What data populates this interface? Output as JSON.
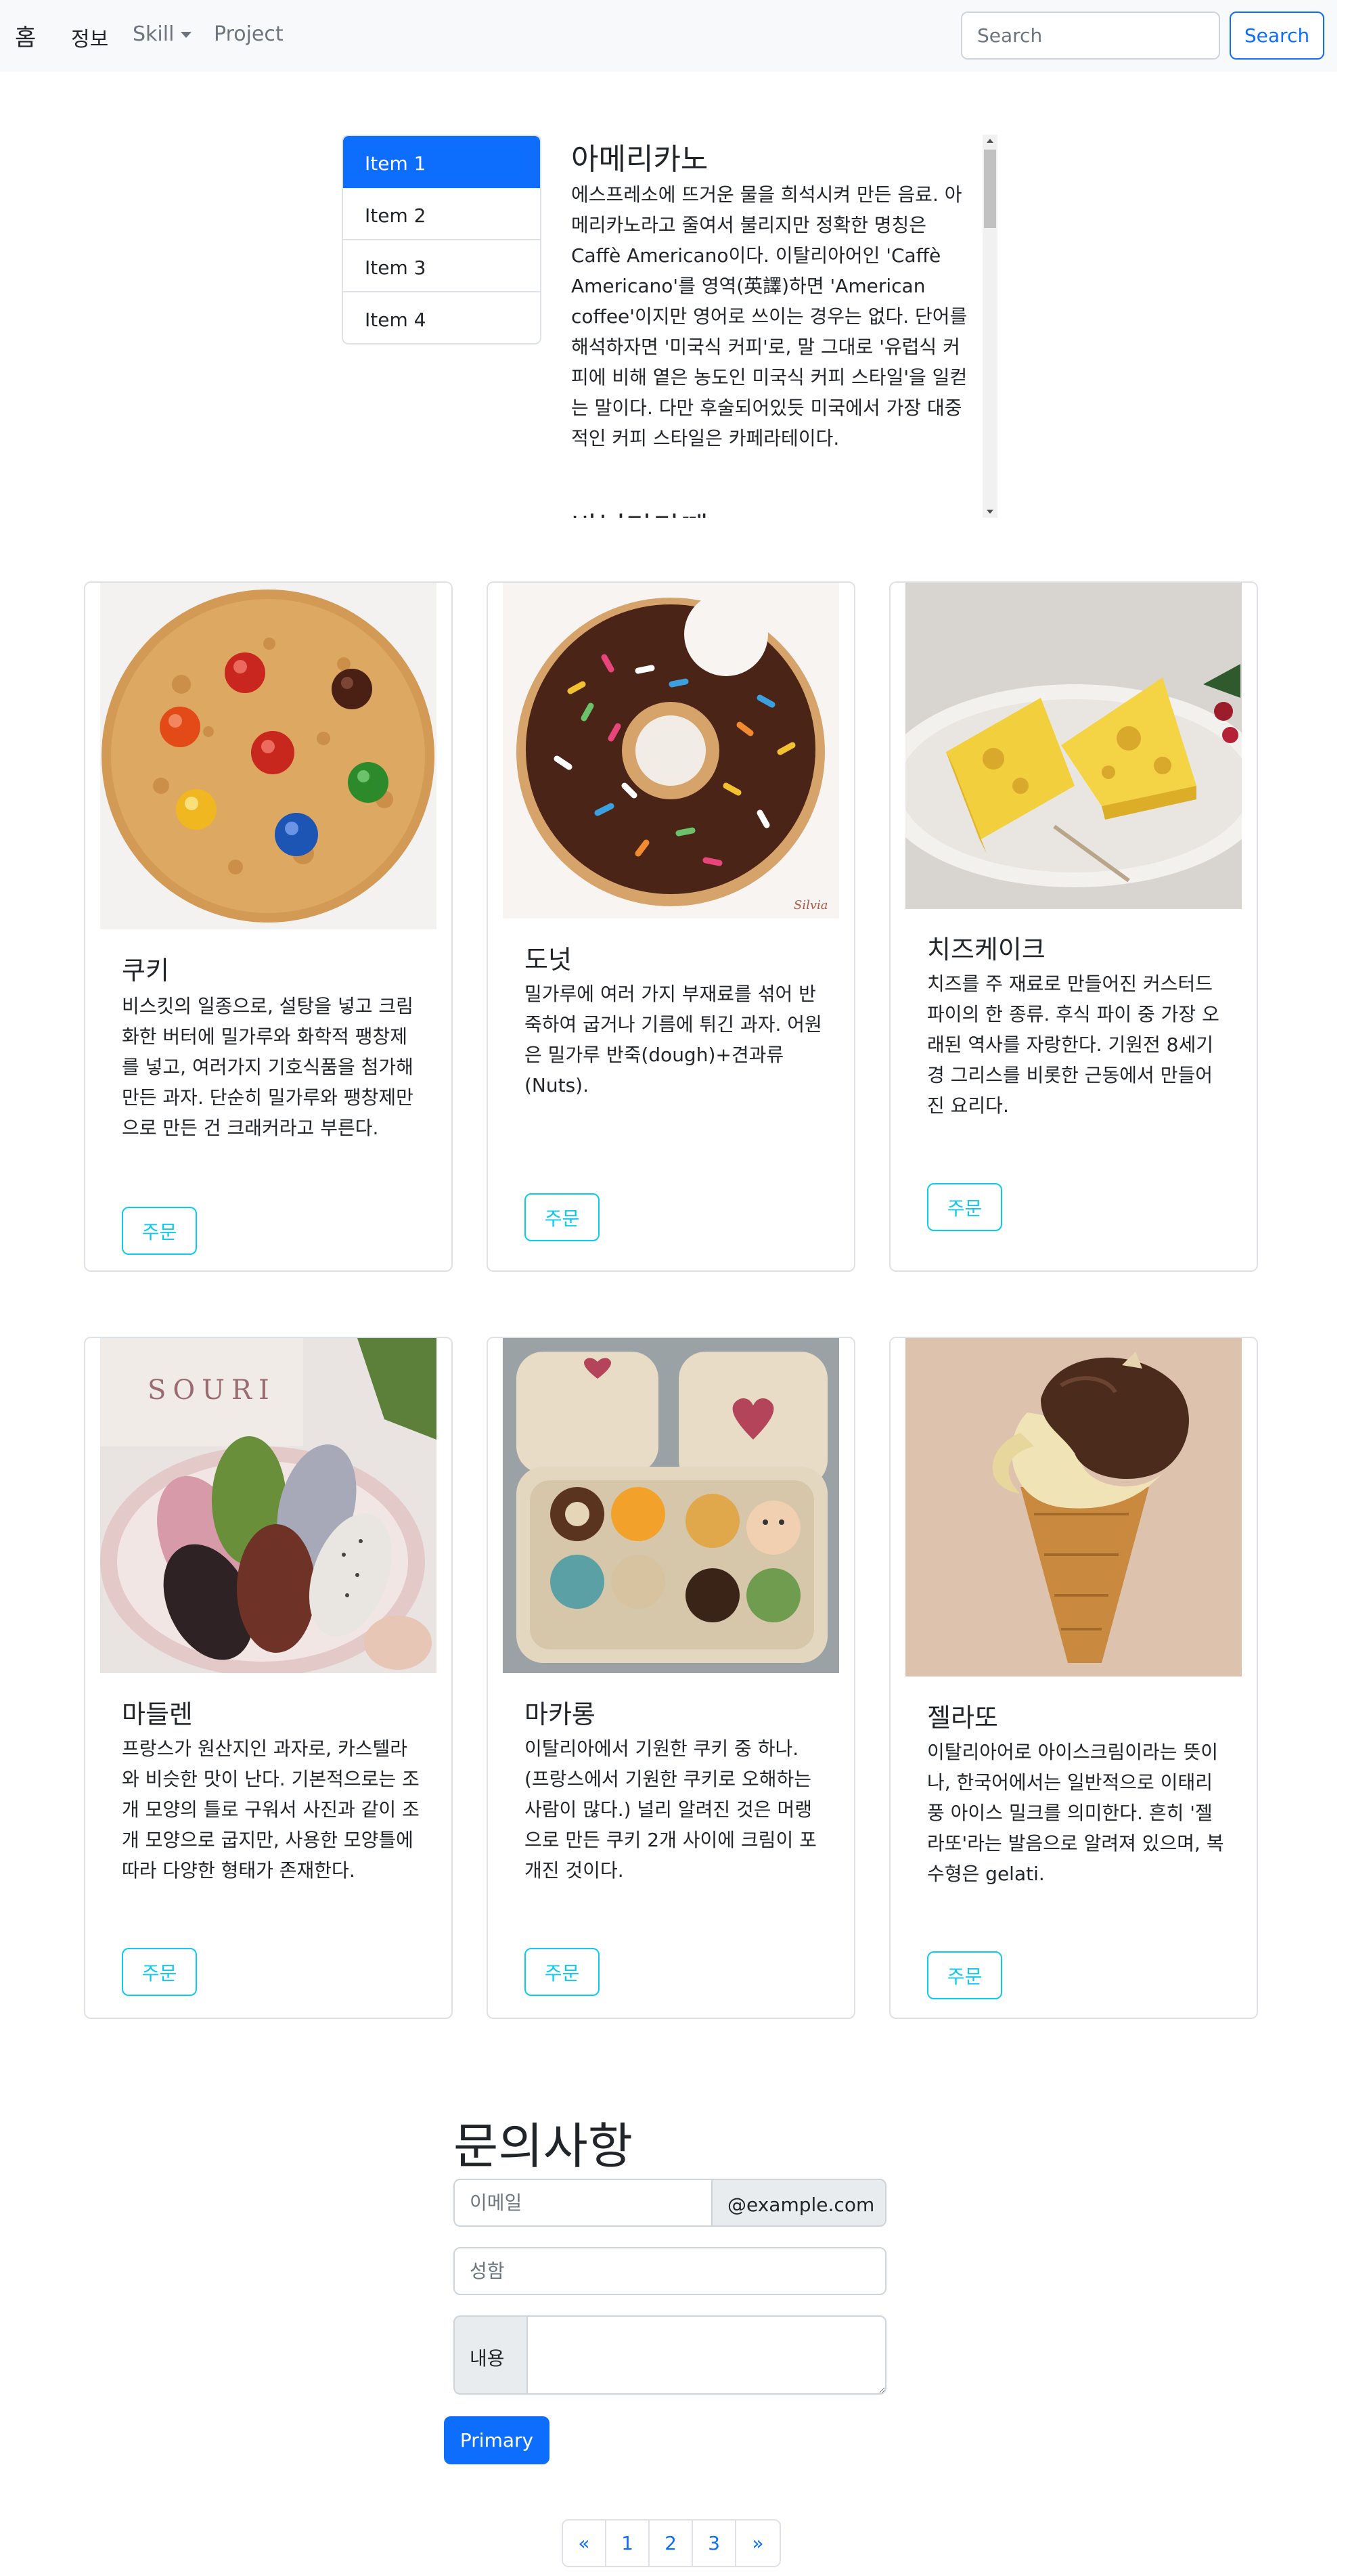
{
  "navbar": {
    "brand": "홈",
    "links": {
      "info": "정보",
      "skill": "Skill",
      "project": "Project"
    },
    "search_placeholder": "Search",
    "search_button": "Search"
  },
  "scrollspy": {
    "items": [
      "Item 1",
      "Item 2",
      "Item 3",
      "Item 4"
    ],
    "active_item": "Item 1",
    "heading": "아메리카노",
    "text": "에스프레소에 뜨거운 물을 희석시켜 만든 음료. 아메리카노라고 줄여서 불리지만 정확한 명칭은 Caffè Americano이다. 이탈리아어인 'Caffè Americano'를 영역(英譯)하면 'American coffee'이지만 영어로 쓰이는 경우는 없다. 단어를 해석하자면 '미국식 커피'로, 말 그대로 '유럽식 커피에 비해 옅은 농도인 미국식 커피 스타일'을 일컫는 말이다. 다만 후술되어있듯 미국에서 가장 대중적인 커피 스타일은 카페라테이다.",
    "next_heading": "바닐라라떼"
  },
  "cards": [
    {
      "title": "쿠키",
      "text": "비스킷의 일종으로, 설탕을 넣고 크림화한 버터에 밀가루와 화학적 팽창제를 넣고, 여러가지 기호식품을 첨가해 만든 과자. 단순히 밀가루와 팽창제만으로 만든 건 크래커라고 부른다.",
      "button": "주문"
    },
    {
      "title": "도넛",
      "text": "밀가루에 여러 가지 부재료를 섞어 반죽하여 굽거나 기름에 튀긴 과자. 어원은 밀가루 반죽(dough)+견과류(Nuts).",
      "button": "주문"
    },
    {
      "title": "치즈케이크",
      "text": "치즈를 주 재료로 만들어진 커스터드 파이의 한 종류. 후식 파이 중 가장 오래된 역사를 자랑한다. 기원전 8세기경 그리스를 비롯한 근동에서 만들어진 요리다.",
      "button": "주문"
    },
    {
      "title": "마들렌",
      "text": "프랑스가 원산지인 과자로, 카스텔라와 비슷한 맛이 난다. 기본적으로는 조개 모양의 틀로 구워서 사진과 같이 조개 모양으로 굽지만, 사용한 모양틀에 따라 다양한 형태가 존재한다.",
      "button": "주문"
    },
    {
      "title": "마카롱",
      "text": "이탈리아에서 기원한 쿠키 중 하나. (프랑스에서 기원한 쿠키로 오해하는 사람이 많다.) 널리 알려진 것은 머랭으로 만든 쿠키 2개 사이에 크림이 포개진 것이다.",
      "button": "주문"
    },
    {
      "title": "젤라또",
      "text": "이탈리아어로 아이스크림이라는 뜻이나, 한국어에서는 일반적으로 이태리풍 아이스 밀크를 의미한다. 흔히 '젤라또'라는 발음으로 알려져 있으며, 복수형은 gelati.",
      "button": "주문"
    }
  ],
  "images": {
    "cheese_box_brand": "SOURI",
    "donut_signature": "Silvia"
  },
  "form": {
    "title": "문의사항",
    "email_placeholder": "이메일",
    "email_suffix": "@example.com",
    "name_placeholder": "성함",
    "content_label": "내용",
    "submit": "Primary"
  },
  "pagination": [
    "«",
    "1",
    "2",
    "3",
    "»"
  ],
  "colors": {
    "primary": "#0d6efd",
    "info": "#0dcaf0",
    "navbar_bg": "#f8f9fa"
  }
}
